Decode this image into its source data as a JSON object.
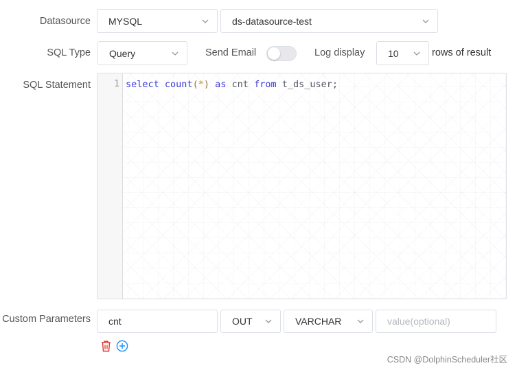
{
  "form": {
    "datasource": {
      "label": "Datasource",
      "type_value": "MYSQL",
      "instance_value": "ds-datasource-test"
    },
    "sql_type": {
      "label": "SQL Type",
      "value": "Query"
    },
    "send_email": {
      "label": "Send Email",
      "enabled": false
    },
    "log_display": {
      "label": "Log display",
      "value": "10",
      "suffix": "rows of result"
    },
    "sql_statement": {
      "label": "SQL Statement",
      "line_number": "1",
      "tokens": {
        "select": "select",
        "count": "count",
        "open_paren": "(",
        "star": "*",
        "close_paren": ")",
        "as": "as",
        "alias": "cnt",
        "from": "from",
        "table": "t_ds_user;"
      }
    },
    "custom_parameters": {
      "label": "Custom Parameters",
      "rows": [
        {
          "name": "cnt",
          "direction": "OUT",
          "type": "VARCHAR",
          "value_placeholder": "value(optional)"
        }
      ]
    }
  },
  "icons": {
    "delete": "trash-icon",
    "add": "plus-circle-icon"
  },
  "colors": {
    "delete_icon": "#e0322b",
    "add_icon": "#1890ff",
    "keyword": "#3a3ad8"
  },
  "watermark": "CSDN @DolphinScheduler社区"
}
